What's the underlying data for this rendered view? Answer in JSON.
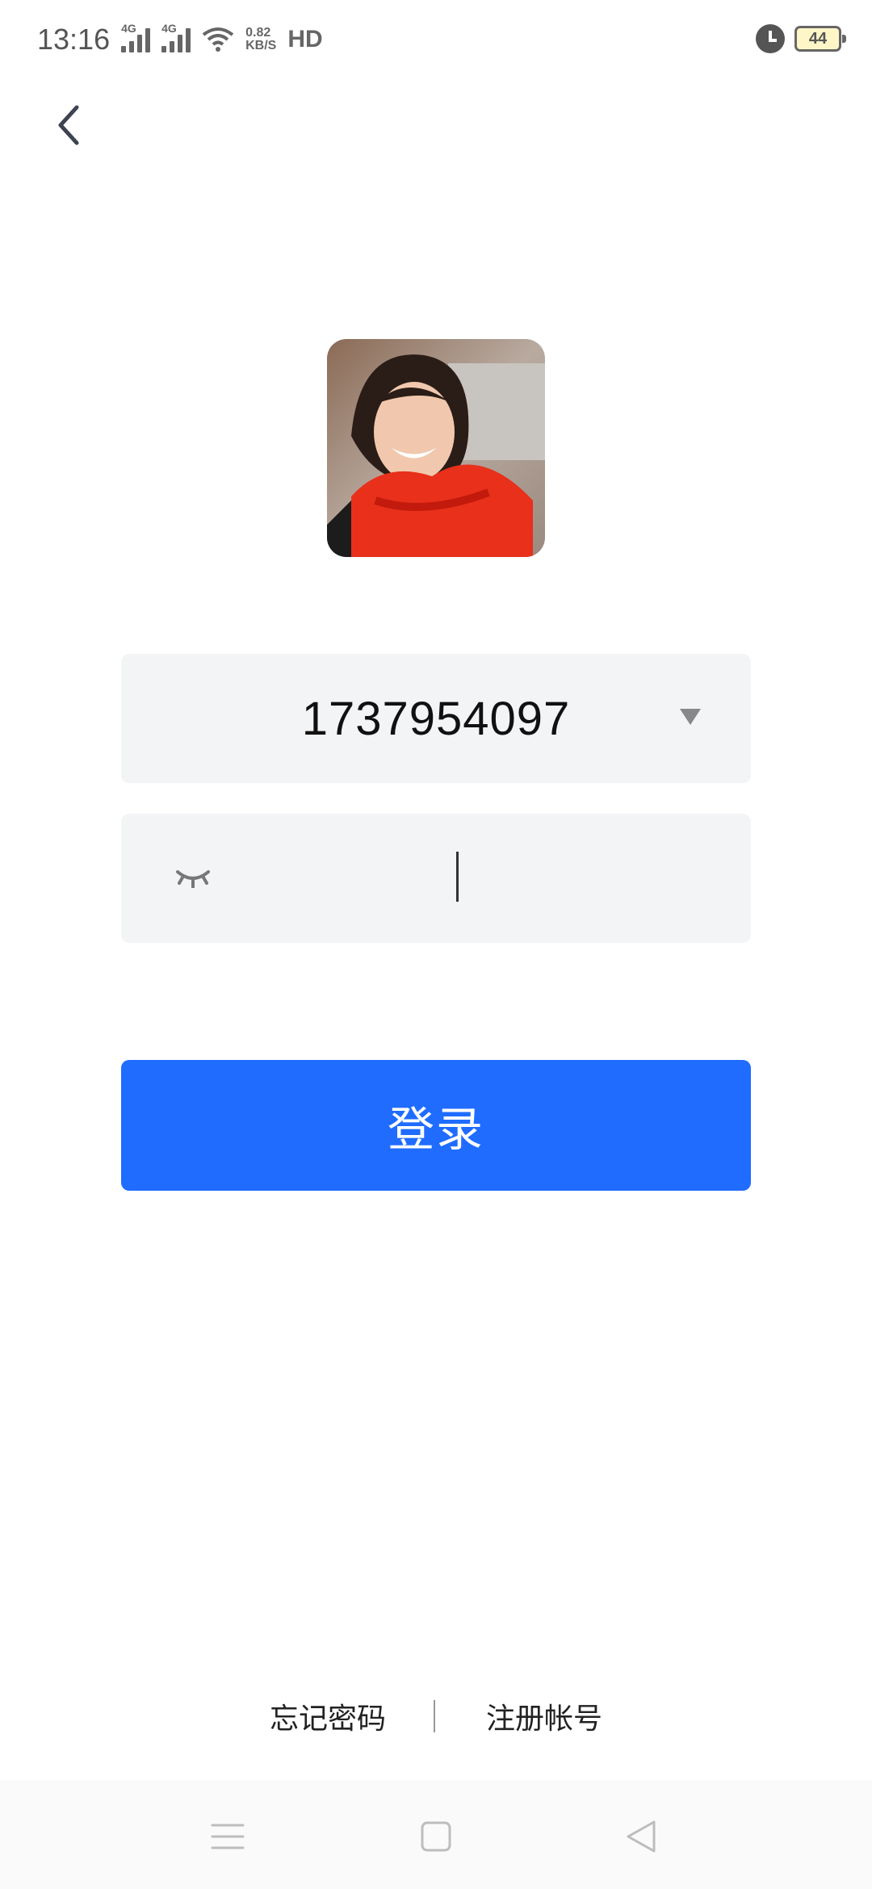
{
  "status_bar": {
    "time": "13:16",
    "signal1_tag": "4G",
    "signal2_tag": "4G",
    "net_speed_value": "0.82",
    "net_speed_unit": "KB/S",
    "hd_label": "HD",
    "battery_level": "44",
    "icons": [
      "signal-icon",
      "signal-icon",
      "wifi-icon",
      "alarm-icon",
      "battery-icon"
    ]
  },
  "header": {
    "back_icon": "chevron-left-icon"
  },
  "avatar": {
    "alt": "avatar photo"
  },
  "account": {
    "value": "1737954097",
    "dropdown_icon": "triangle-down-icon"
  },
  "password": {
    "value": "",
    "visibility_icon": "eye-closed-icon"
  },
  "login_button": {
    "label": "登录",
    "color": "#1f6cff"
  },
  "bottom_links": {
    "forgot": "忘记密码",
    "separator": "|",
    "register": "注册帐号"
  },
  "nav_bar": {
    "icons": [
      "menu-icon",
      "home-icon",
      "back-icon"
    ]
  }
}
